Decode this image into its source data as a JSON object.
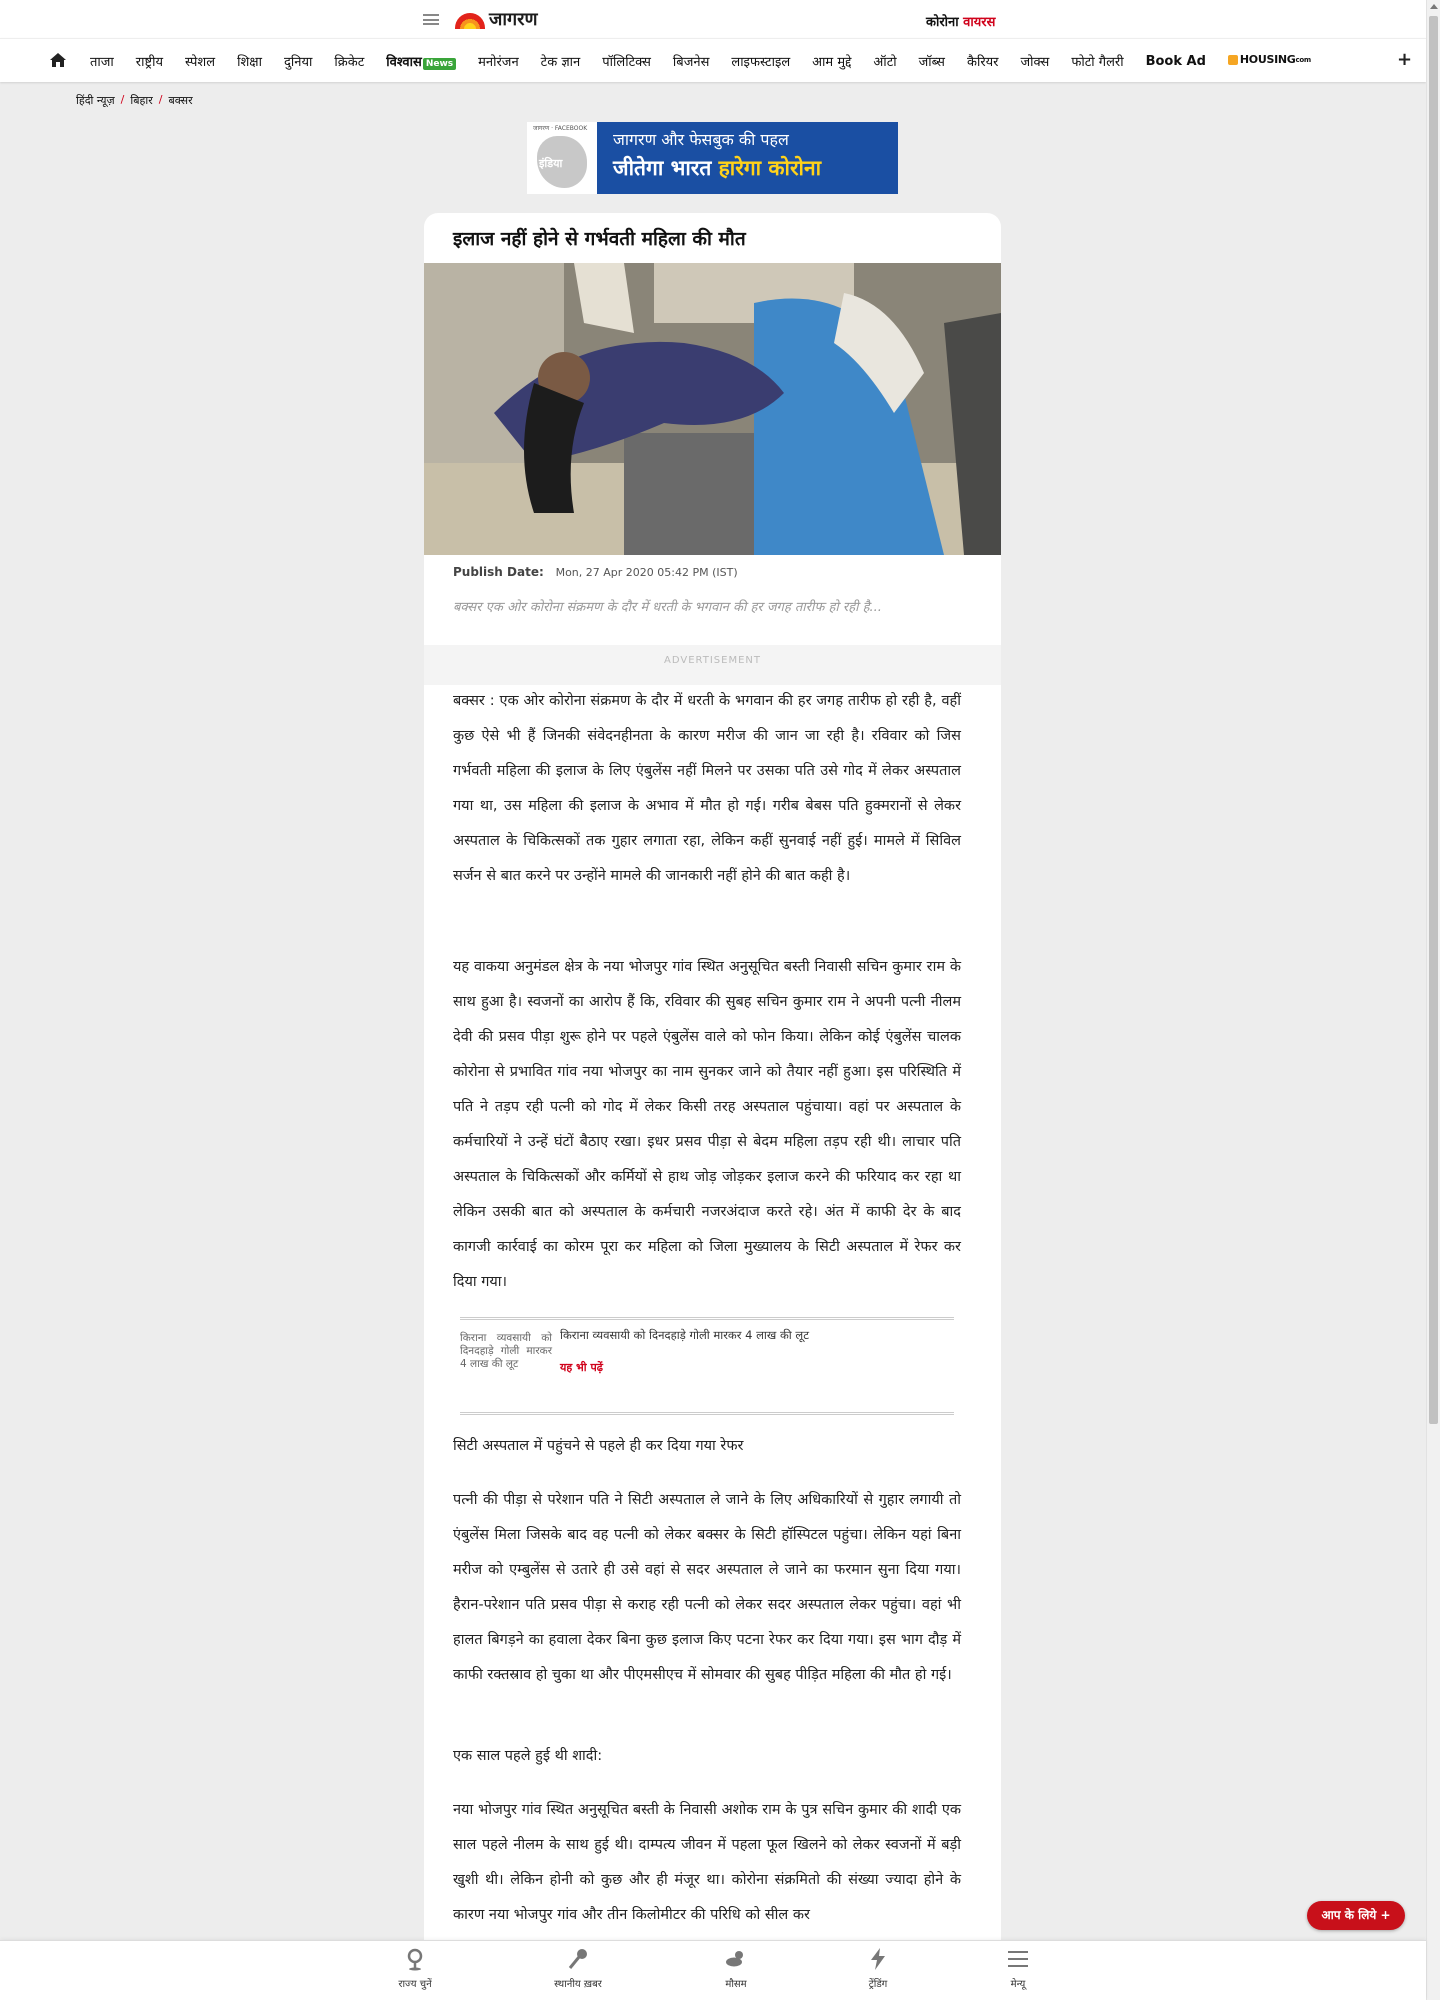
{
  "header": {
    "logo_text": "जागरण",
    "corona_prefix": "कोरोना",
    "corona_suffix": "वायरस"
  },
  "nav": {
    "items": [
      "ताजा",
      "राष्ट्रीय",
      "स्पेशल",
      "शिक्षा",
      "दुनिया",
      "क्रिकेट",
      "विश्वास",
      "मनोरंजन",
      "टेक ज्ञान",
      "पॉलिटिक्स",
      "बिजनेस",
      "लाइफस्टाइल",
      "आम मुद्दे",
      "ऑटो",
      "जॉब्स",
      "कैरियर",
      "जोक्स",
      "फोटो गैलरी",
      "Book Ad"
    ],
    "vishwas_badge": "News",
    "housing_label": "HOUSING",
    "housing_suffix": "com",
    "plus": "+"
  },
  "breadcrumb": [
    "हिंदी न्यूज़",
    "बिहार",
    "बक्सर"
  ],
  "banner": {
    "small": "जागरण · FACEBOOK",
    "map_text": "इंडिया",
    "line1": "जागरण और फेसबुक की पहल",
    "line2_a": "जीतेगा भारत",
    "line2_b": "हारेगा कोरोना"
  },
  "article": {
    "title": "इलाज नहीं होने से गर्भवती महिला की मौत",
    "publish_label": "Publish Date:",
    "publish_date": "Mon, 27 Apr 2020 05:42 PM (IST)",
    "summary": "बक्सर एक ओर कोरोना संक्रमण के दौर में धरती के भगवान की हर जगह तारीफ हो रही है...",
    "advertisement": "ADVERTISEMENT",
    "p1": "बक्सर : एक ओर कोरोना संक्रमण के दौर में धरती के भगवान की हर जगह तारीफ हो रही है, वहीं कुछ ऐसे भी हैं जिनकी संवेदनहीनता के कारण मरीज की जान जा रही है। रविवार को जिस गर्भवती महिला की इलाज के लिए एंबुलेंस नहीं मिलने पर उसका पति उसे गोद में लेकर अस्पताल गया था, उस महिला की इलाज के अभाव में मौत हो गई। गरीब बेबस पति हुक्मरानों से लेकर अस्पताल के चिकित्सकों तक गुहार लगाता रहा, लेकिन कहीं सुनवाई नहीं हुई। मामले में सिविल सर्जन से बात करने पर उन्होंने मामले की जानकारी नहीं होने की बात कही है।",
    "p2": "यह वाकया अनुमंडल क्षेत्र के नया भोजपुर गांव स्थित अनुसूचित बस्ती निवासी सचिन कुमार राम के साथ हुआ है। स्वजनों का आरोप हैं कि, रविवार की सुबह सचिन कुमार राम ने अपनी पत्नी नीलम देवी की प्रसव पीड़ा शुरू होने पर पहले एंबुलेंस वाले को फोन किया। लेकिन कोई एंबुलेंस चालक कोरोना से प्रभावित गांव नया भोजपुर का नाम सुनकर जाने को तैयार नहीं हुआ। इस परिस्थिति में पति ने तड़प रही पत्नी को गोद में लेकर किसी तरह अस्पताल पहुंचाया। वहां पर अस्पताल के कर्मचारियों ने उन्हें घंटों बैठाए रखा। इधर प्रसव पीड़ा से बेदम महिला तड़प रही थी। लाचार पति अस्पताल के चिकित्सकों और कर्मियों से हाथ जोड़ जोड़कर इलाज करने की फरियाद कर रहा था लेकिन उसकी बात को अस्पताल के कर्मचारी नजरअंदाज करते रहे। अंत में काफी देर के बाद कागजी कार्रवाई का कोरम पूरा कर महिला को जिला मुख्यालय के सिटी अस्पताल में रेफर कर दिया गया।",
    "read_also_img_alt": "किराना व्यवसायी को दिनदहाड़े गोली मारकर 4 लाख की लूट",
    "read_also_title": "किराना व्यवसायी को दिनदहाड़े गोली मारकर 4 लाख की लूट",
    "read_also_tag": "यह भी पढ़ें",
    "p3": "सिटी अस्पताल में पहुंचने से पहले ही कर दिया गया रेफर",
    "p4": "पत्नी की पीड़ा से परेशान पति ने सिटी अस्पताल ले जाने के लिए अधिकारियों से गुहार लगायी तो एंबुलेंस मिला जिसके बाद वह पत्नी को लेकर बक्सर के सिटी हॉस्पिटल पहुंचा। लेकिन यहां बिना मरीज को एम्बुलेंस से उतारे ही उसे वहां से सदर अस्पताल ले जाने का फरमान सुना दिया गया। हैरान-परेशान पति प्रसव पीड़ा से कराह रही पत्नी को लेकर सदर अस्पताल लेकर पहुंचा। वहां भी हालत बिगड़ने का हवाला देकर बिना कुछ इलाज किए पटना रेफर कर दिया गया। इस भाग दौड़ में काफी रक्तस्राव हो चुका था और पीएमसीएच में सोमवार की सुबह पीड़ित महिला की मौत हो गई।",
    "p5": "एक साल पहले हुई थी शादी:",
    "p6": "नया भोजपुर गांव स्थित अनुसूचित बस्ती के निवासी अशोक राम के पुत्र सचिन कुमार की शादी एक साल पहले नीलम के साथ हुई थी। दाम्पत्य जीवन में पहला फूल खिलने को लेकर स्वजनों में बड़ी खुशी थी। लेकिन होनी को कुछ और ही मंजूर था। कोरोना संक्रमितो की संख्या ज्यादा होने के कारण नया भोजपुर गांव और तीन किलोमीटर की परिधि को सील कर"
  },
  "floating_button": "आप के लिये +",
  "bottom_nav": [
    {
      "label": "राज्य चुनें",
      "icon": "location-pin-icon"
    },
    {
      "label": "स्थानीय ख़बर",
      "icon": "microphone-icon"
    },
    {
      "label": "मौसम",
      "icon": "weather-icon"
    },
    {
      "label": "ट्रेंडिंग",
      "icon": "lightning-icon"
    },
    {
      "label": "मेन्यू",
      "icon": "menu-icon"
    }
  ],
  "colors": {
    "accent_red": "#d0021b",
    "banner_blue": "#1a4fa3",
    "banner_yellow": "#ffd21a"
  }
}
